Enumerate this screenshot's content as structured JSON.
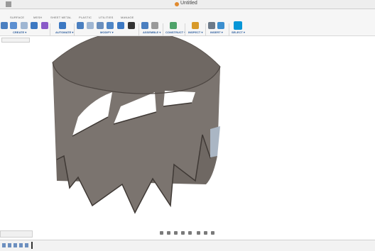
{
  "window": {
    "title": "Untitled"
  },
  "tabs": [
    "SURFACE",
    "MESH",
    "SHEET METAL",
    "PLASTIC",
    "UTILITIES",
    "MANAGE"
  ],
  "groups": {
    "create": "CREATE ▾",
    "automate": "AUTOMATE ▾",
    "modify": "MODIFY ▾",
    "assemble": "ASSEMBLE ▾",
    "construct": "CONSTRUCT ▾",
    "inspect": "INSPECT ▾",
    "insert": "INSERT ▾",
    "select": "SELECT ▾"
  },
  "colors": {
    "accent": "#0696d7",
    "body": "#7b746f",
    "body_dark": "#4d4642"
  }
}
